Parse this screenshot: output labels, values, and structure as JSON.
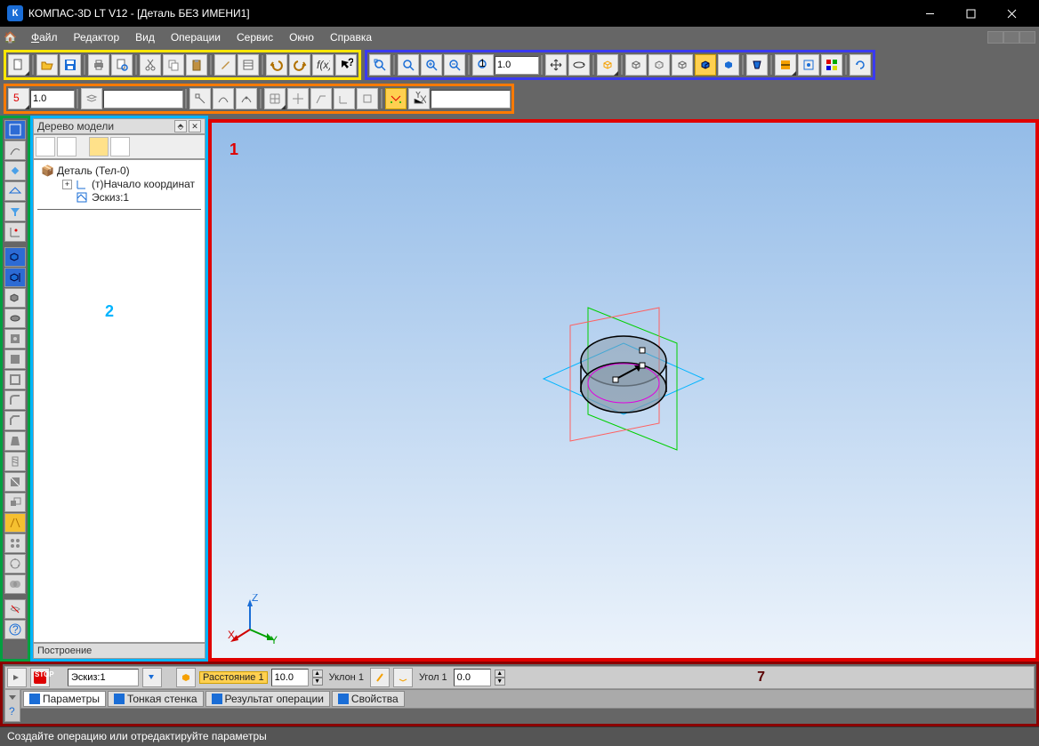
{
  "app": {
    "title": "КОМПАС-3D LT V12 - [Деталь БЕЗ ИМЕНИ1]",
    "icon_letter": "К"
  },
  "menu": {
    "file": "Файл",
    "editor": "Редактор",
    "view": "Вид",
    "operations": "Операции",
    "service": "Сервис",
    "window": "Окно",
    "help": "Справка"
  },
  "toolbar_blue": {
    "zoom_value": "1.0"
  },
  "toolbar_orange": {
    "scale_value": "1.0"
  },
  "tree": {
    "header": "Дерево модели",
    "root": "Деталь (Тел-0)",
    "origin": "(т)Начало координат",
    "sketch1": "Эскиз:1",
    "status": "Построение",
    "marker": "2"
  },
  "canvas": {
    "marker": "1",
    "axis_x": "X",
    "axis_y": "Y",
    "axis_z": "Z"
  },
  "params": {
    "sketch_value": "Эскиз:1",
    "distance_label": "Расстояние 1",
    "distance_value": "10.0",
    "slope_label": "Уклон 1",
    "angle_label": "Угол 1",
    "angle_value": "0.0",
    "marker": "7",
    "tabs": {
      "parameters": "Параметры",
      "thin_wall": "Тонкая стенка",
      "result": "Результат операции",
      "properties": "Свойства"
    }
  },
  "status": {
    "text": "Создайте операцию или отредактируйте параметры"
  }
}
